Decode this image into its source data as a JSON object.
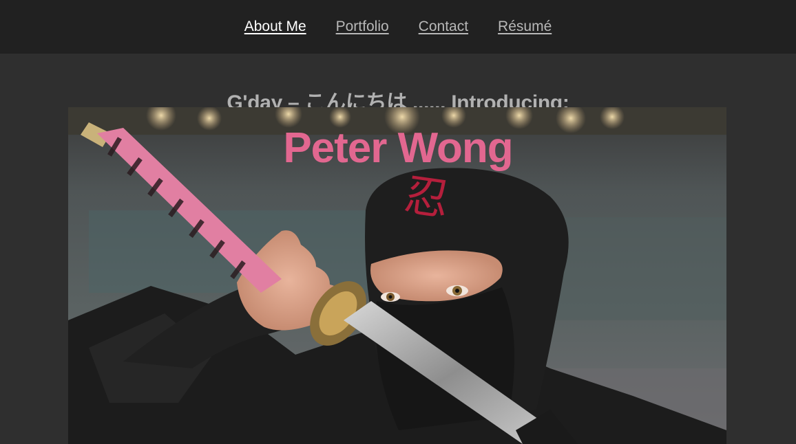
{
  "nav": {
    "items": [
      {
        "label": "About Me",
        "active": true
      },
      {
        "label": "Portfolio",
        "active": false
      },
      {
        "label": "Contact",
        "active": false
      },
      {
        "label": "Résumé",
        "active": false
      }
    ]
  },
  "intro": {
    "heading": "G'day – こんにちは ...... Introducing:"
  },
  "hero": {
    "name": "Peter Wong",
    "headband_symbol": "忍"
  },
  "colors": {
    "page_background": "#2f2f2f",
    "nav_background": "#212121",
    "nav_link": "#b8b8b8",
    "nav_link_active": "#ffffff",
    "heading": "#b1b1b1",
    "name_accent": "#e26790",
    "katana_handle": "#e17fa2"
  }
}
